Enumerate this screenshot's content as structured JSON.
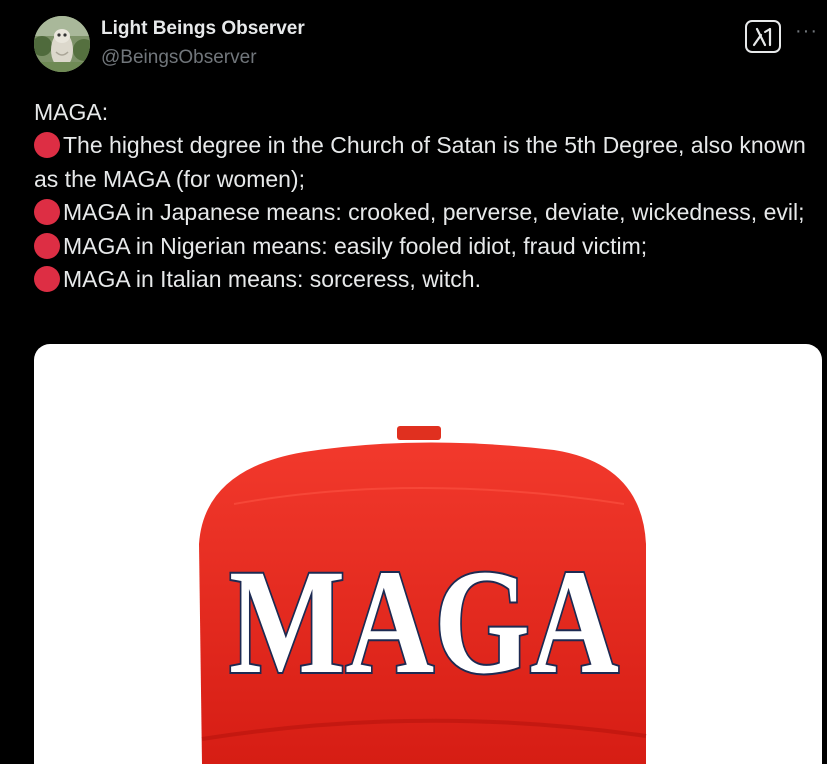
{
  "author": {
    "display_name": "Light Beings Observer",
    "handle": "@BeingsObserver",
    "avatar_icon": "owl-statue-avatar"
  },
  "header_actions": {
    "grok_icon": "grok-icon",
    "more_label": "···"
  },
  "post": {
    "lines": [
      "MAGA:",
      "The highest degree in the Church of Satan is the 5th Degree, also known as the MAGA (for women);",
      "MAGA in Japanese means: crooked, perverse, deviate, wickedness, evil;",
      "MAGA in Nigerian means: easily fooled idiot, fraud victim;",
      "MAGA in Italian means: sorceress, witch."
    ],
    "bullet_icon": "red-circle-emoji",
    "bullet_color": "#dd2e44"
  },
  "media": {
    "hat_text": "MAGA",
    "hat_color": "#e8231c"
  }
}
